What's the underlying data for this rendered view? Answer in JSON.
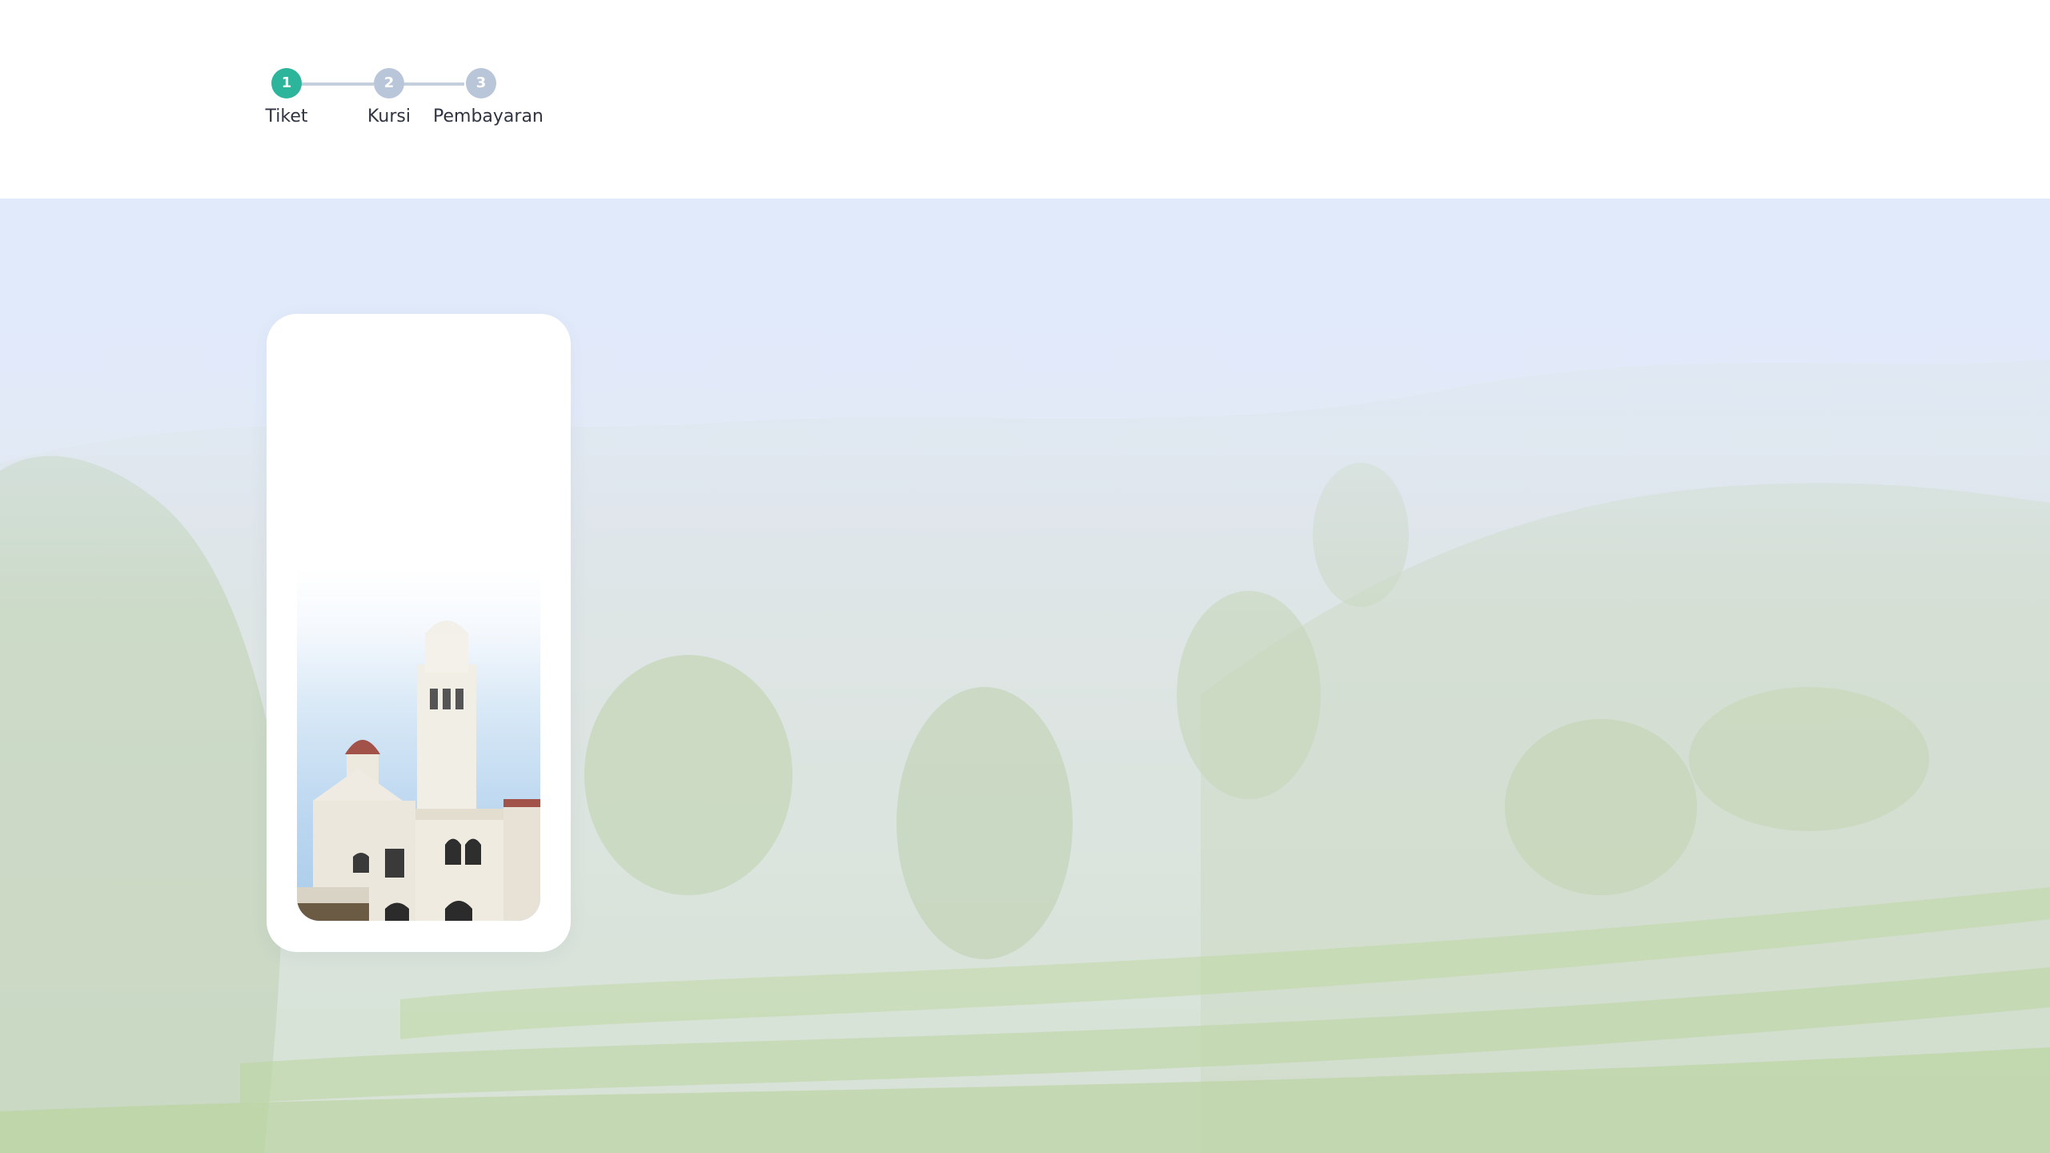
{
  "stepper": {
    "steps": [
      {
        "number": "1",
        "label": "Tiket",
        "state": "active"
      },
      {
        "number": "2",
        "label": "Kursi",
        "state": "inactive"
      },
      {
        "number": "3",
        "label": "Pembayaran",
        "state": "inactive"
      }
    ]
  },
  "colors": {
    "active_step": "#2cb59a",
    "inactive_step": "#b9c5d8",
    "connector": "#c4cfdd",
    "hero_sky": "#dfe9fb",
    "hero_field": "#c9dcb3",
    "card_background": "#ffffff"
  },
  "hero": {
    "background_image": "misty-rice-terraces-landscape"
  },
  "card": {
    "image": "lawang-sewu-building-photo"
  }
}
